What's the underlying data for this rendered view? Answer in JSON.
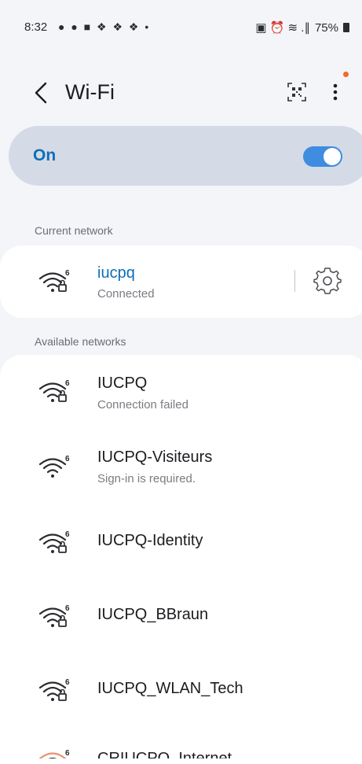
{
  "status_bar": {
    "time": "8:32",
    "left_icons": "● ● ■ ❖ ❖ ❖ •",
    "right_icons": "▣ ⏰ ≋ .∥",
    "battery": "75%"
  },
  "header": {
    "title": "Wi-Fi",
    "icons": [
      "back-icon",
      "qr-code-icon",
      "more-options-icon"
    ],
    "badge_color": "#f26a2a"
  },
  "toggle": {
    "label": "On",
    "state": true,
    "accent": "#3f8ce0"
  },
  "current_network": {
    "section_label": "Current network",
    "name": "iucpq",
    "status": "Connected"
  },
  "available": {
    "section_label": "Available networks",
    "networks": [
      {
        "name": "IUCPQ",
        "status": "Connection failed",
        "secured": true
      },
      {
        "name": "IUCPQ-Visiteurs",
        "status": "Sign-in is required.",
        "secured": false
      },
      {
        "name": "IUCPQ-Identity",
        "status": "",
        "secured": true
      },
      {
        "name": "IUCPQ_BBraun",
        "status": "",
        "secured": true
      },
      {
        "name": "IUCPQ_WLAN_Tech",
        "status": "",
        "secured": true
      },
      {
        "name": "CRIUCPQ_Internet",
        "status": "",
        "secured": true
      }
    ]
  }
}
